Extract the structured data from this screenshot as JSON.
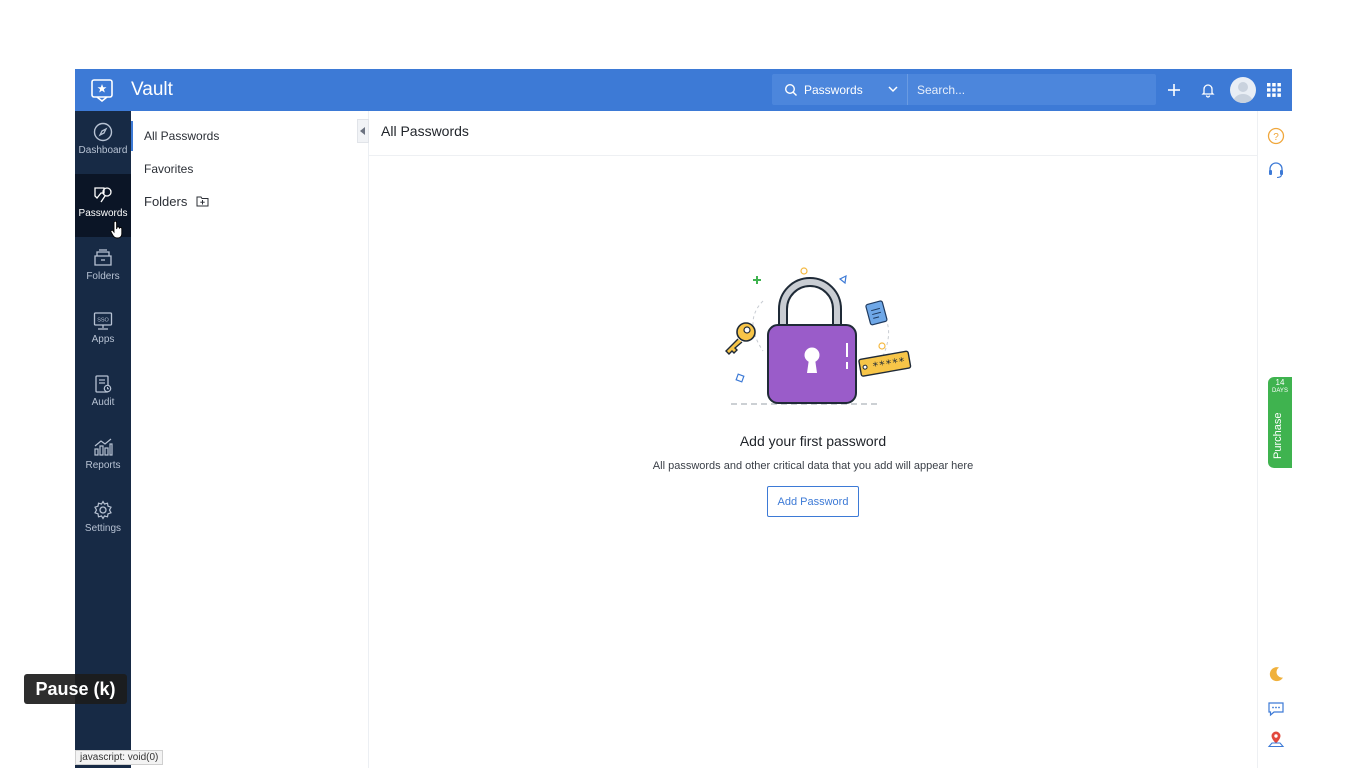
{
  "topbar": {
    "app_title": "Vault",
    "search_scope": "Passwords",
    "search_placeholder": "Search...",
    "icons": [
      "vault-logo-icon",
      "search-icon",
      "chevron-down-icon",
      "plus-icon",
      "bell-icon",
      "avatar",
      "app-grid-icon"
    ],
    "color": "#3d7ad6"
  },
  "sidenav": {
    "items": [
      {
        "label": "Dashboard",
        "icon": "compass-icon",
        "active": false
      },
      {
        "label": "Passwords",
        "icon": "key-icon",
        "active": true
      },
      {
        "label": "Folders",
        "icon": "folder-icon",
        "active": false
      },
      {
        "label": "Apps",
        "icon": "sso-icon",
        "active": false
      },
      {
        "label": "Audit",
        "icon": "audit-clipboard-icon",
        "active": false
      },
      {
        "label": "Reports",
        "icon": "chart-icon",
        "active": false
      },
      {
        "label": "Settings",
        "icon": "gear-icon",
        "active": false
      }
    ],
    "color": "#172a45"
  },
  "subnav": {
    "items": [
      {
        "label": "All Passwords",
        "active": true
      },
      {
        "label": "Favorites",
        "active": false
      },
      {
        "label": "Folders",
        "active": false
      }
    ]
  },
  "main": {
    "title": "All Passwords",
    "empty_title": "Add your first password",
    "empty_subtitle": "All passwords and other critical data that you add will appear here",
    "add_button": "Add Password",
    "illustration_mask": "*****"
  },
  "rightrail": {
    "icons": [
      "help-icon",
      "support-headset-icon",
      "moon-icon",
      "chat-icon",
      "location-pin-icon"
    ],
    "trial_days": "14",
    "trial_days_label": "DAYS",
    "purchase_label": "Purchase",
    "purchase_color": "#3fb34f"
  },
  "overlay": {
    "pause_tooltip": "Pause (k)",
    "status_url": "javascript: void(0)"
  }
}
